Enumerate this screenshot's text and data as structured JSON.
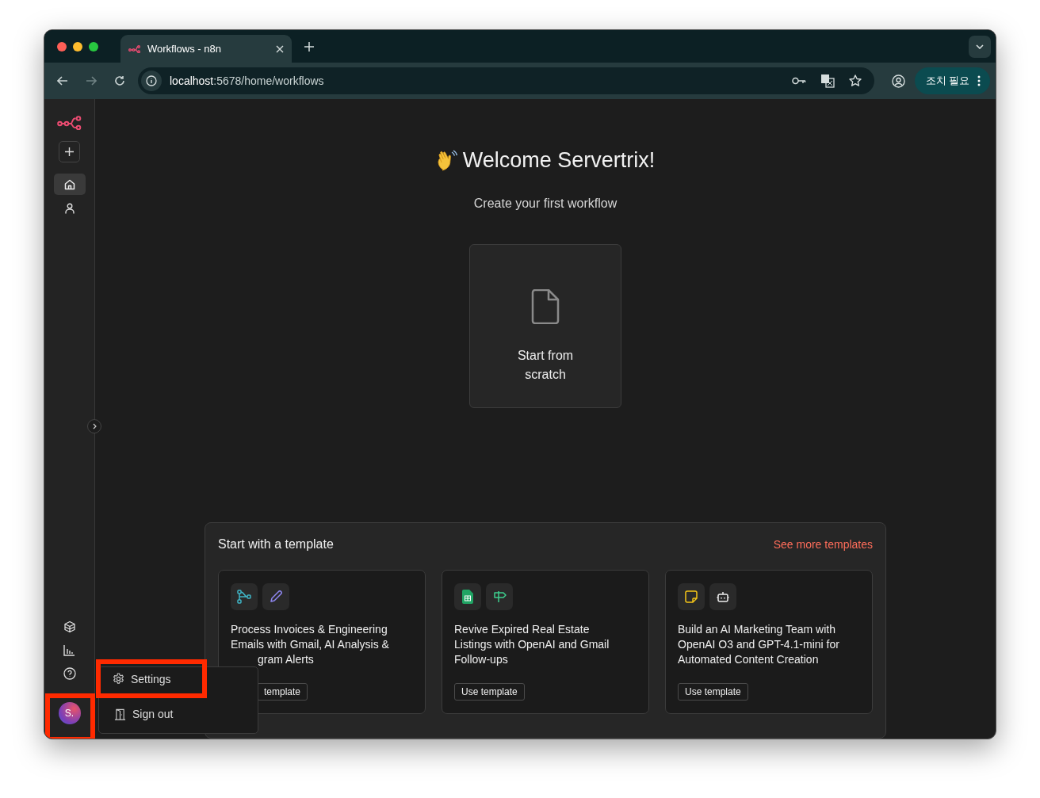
{
  "browser": {
    "tab": {
      "title": "Workflows - n8n",
      "selected": true
    },
    "address": {
      "host": "localhost",
      "path": ":5678/home/workflows"
    },
    "profile_button": "조치 필요"
  },
  "sidebar": {
    "nav": [
      {
        "kind": "home",
        "selected": true
      },
      {
        "kind": "user",
        "selected": false
      }
    ],
    "avatar": {
      "initials": "S.",
      "highlighted": true
    }
  },
  "user_menu": {
    "items": [
      {
        "kind": "settings",
        "label": "Settings",
        "highlighted": true
      },
      {
        "kind": "sign_out",
        "label": "Sign out",
        "highlighted": false
      }
    ]
  },
  "main": {
    "greeting": "Welcome Servertrix!",
    "subtitle": "Create your first workflow",
    "start_card": "Start from scratch",
    "templates": {
      "title": "Start with a template",
      "more_link": "See more templates",
      "cards": [
        {
          "icons": [
            {
              "kind": "flow"
            },
            {
              "kind": "pencil"
            }
          ],
          "title_lines": [
            {
              "text": "Process Invoices & Engineering",
              "hidden_start": false
            },
            {
              "text": "Emails with Gmail, AI Analysis &",
              "hidden_start": false
            },
            {
              "text": "gram Alerts",
              "hidden_start": true
            }
          ],
          "button": {
            "label": "template",
            "hidden_start": true
          }
        },
        {
          "icons": [
            {
              "kind": "sheet"
            },
            {
              "kind": "signpost"
            }
          ],
          "title_lines": [
            {
              "text": "Revive Expired Real Estate",
              "hidden_start": false
            },
            {
              "text": "Listings with OpenAI and Gmail",
              "hidden_start": false
            },
            {
              "text": "Follow-ups",
              "hidden_start": false
            }
          ],
          "button": {
            "label": "Use template",
            "hidden_start": false
          }
        },
        {
          "icons": [
            {
              "kind": "note"
            },
            {
              "kind": "robot"
            }
          ],
          "title_lines": [
            {
              "text": "Build an AI Marketing Team with",
              "hidden_start": false
            },
            {
              "text": "OpenAI O3 and GPT-4.1-mini for",
              "hidden_start": false
            },
            {
              "text": "Automated Content Creation",
              "hidden_start": false
            }
          ],
          "button": {
            "label": "Use template",
            "hidden_start": false
          }
        }
      ]
    }
  }
}
